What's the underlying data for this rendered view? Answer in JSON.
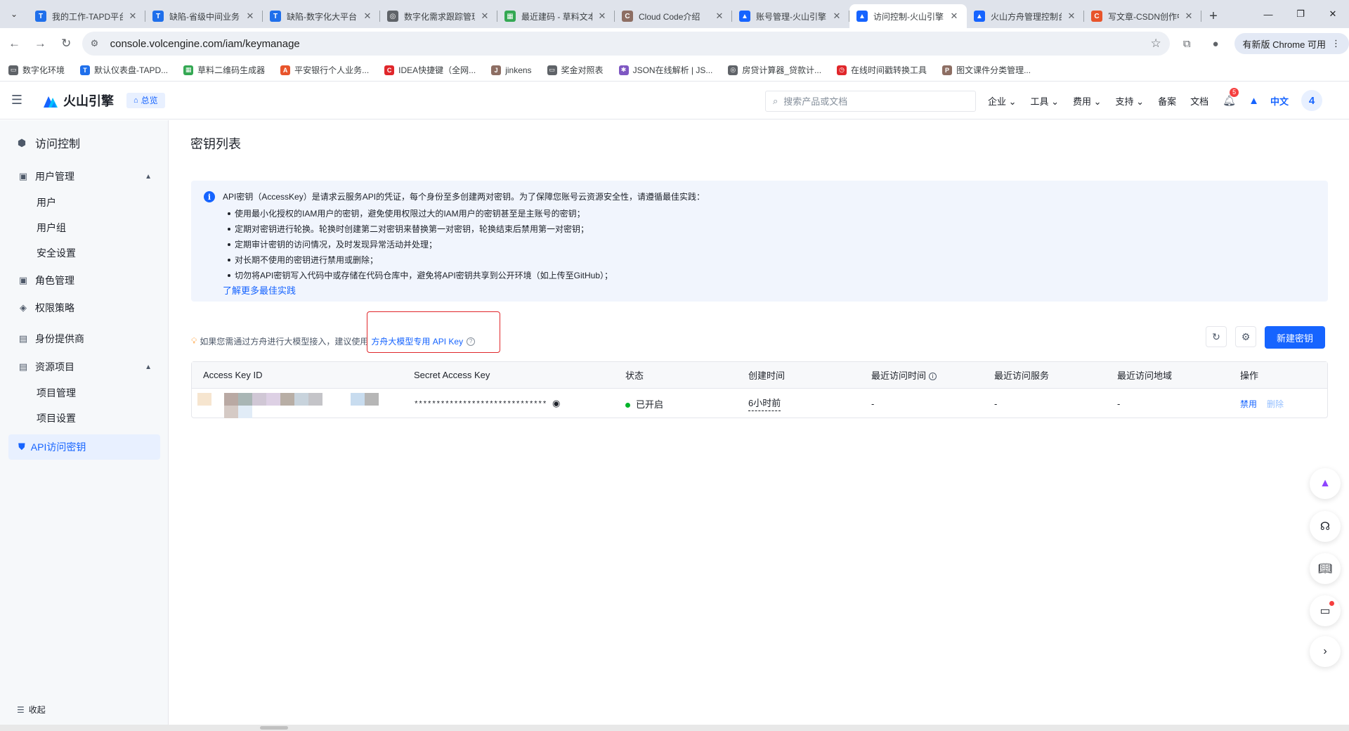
{
  "browser": {
    "tabs": [
      {
        "title": "我的工作-TAPD平台",
        "fav_color": "#1f6feb",
        "fav": "T"
      },
      {
        "title": "缺陷-省级中间业务",
        "fav_color": "#1f6feb",
        "fav": "T"
      },
      {
        "title": "缺陷-数字化大平台",
        "fav_color": "#1f6feb",
        "fav": "T"
      },
      {
        "title": "数字化需求跟踪管理",
        "fav_color": "#5f6368",
        "fav": "◎"
      },
      {
        "title": "最近建码 - 草料文本",
        "fav_color": "#34a853",
        "fav": "▦"
      },
      {
        "title": "Cloud Code介绍",
        "fav_color": "#8d6e63",
        "fav": "C"
      },
      {
        "title": "账号管理-火山引擎",
        "fav_color": "#1664ff",
        "fav": "▲"
      },
      {
        "title": "访问控制-火山引擎",
        "fav_color": "#1664ff",
        "fav": "▲",
        "active": true
      },
      {
        "title": "火山方舟管理控制台",
        "fav_color": "#1664ff",
        "fav": "▲"
      },
      {
        "title": "写文章-CSDN创作中心",
        "fav_color": "#e8542b",
        "fav": "C"
      }
    ],
    "url": "console.volcengine.com/iam/keymanage",
    "update_label": "有新版 Chrome 可用",
    "bookmarks": [
      {
        "label": "数字化环境",
        "color": "#5f6368",
        "fav": "▭"
      },
      {
        "label": "默认仪表盘-TAPD...",
        "color": "#1f6feb",
        "fav": "T"
      },
      {
        "label": "草料二维码生成器",
        "color": "#34a853",
        "fav": "▦"
      },
      {
        "label": "平安银行个人业务...",
        "color": "#e8542b",
        "fav": "A"
      },
      {
        "label": "IDEA快捷键（全网...",
        "color": "#e0272b",
        "fav": "C"
      },
      {
        "label": "jinkens",
        "color": "#8d6e63",
        "fav": "J"
      },
      {
        "label": "奖金对照表",
        "color": "#5f6368",
        "fav": "▭"
      },
      {
        "label": "JSON在线解析 | JS...",
        "color": "#7e57c2",
        "fav": "✱"
      },
      {
        "label": "房贷计算器_贷款计...",
        "color": "#5f6368",
        "fav": "◎"
      },
      {
        "label": "在线时间戳转换工具",
        "color": "#e0272b",
        "fav": "◷"
      },
      {
        "label": "图文课件分类管理...",
        "color": "#8d6e63",
        "fav": "P"
      }
    ]
  },
  "header": {
    "brand": "火山引擎",
    "overview": "总览",
    "search_placeholder": "搜索产品或文档",
    "menus": [
      "企业 ⌄",
      "工具 ⌄",
      "费用 ⌄",
      "支持 ⌄",
      "备案",
      "文档"
    ],
    "badge_count": "5",
    "lang": "中文",
    "avatar": "4"
  },
  "sidebar": {
    "title": "访问控制",
    "groups": {
      "user_mgmt": "用户管理",
      "role_mgmt": "角色管理",
      "policy": "权限策略",
      "idp": "身份提供商",
      "resource": "资源项目"
    },
    "items": {
      "user": "用户",
      "user_group": "用户组",
      "security": "安全设置",
      "project_mgmt": "项目管理",
      "project_settings": "项目设置"
    },
    "active": "API访问密钥",
    "collapse": "收起"
  },
  "main": {
    "title": "密钥列表",
    "notice": {
      "head": "API密钥（AccessKey）是请求云服务API的凭证，每个身份至多创建两对密钥。为了保障您账号云资源安全性，请遵循最佳实践：",
      "items": [
        "使用最小化授权的IAM用户的密钥，避免使用权限过大的IAM用户的密钥甚至是主账号的密钥；",
        "定期对密钥进行轮换。轮换时创建第二对密钥来替换第一对密钥，轮换结束后禁用第一对密钥；",
        "定期审计密钥的访问情况，及时发现异常活动并处理；",
        "对长期不使用的密钥进行禁用或删除；",
        "切勿将API密钥写入代码中或存储在代码仓库中，避免将API密钥共享到公开环境（如上传至GitHub）；"
      ],
      "more": "了解更多最佳实践"
    },
    "hint": "如果您需通过方舟进行大模型接入，建议使用",
    "hint_link": "方舟大模型专用 API Key",
    "new_button": "新建密钥",
    "table": {
      "headers": [
        "Access Key ID",
        "Secret Access Key",
        "状态",
        "创建时间",
        "最近访问时间",
        "最近访问服务",
        "最近访问地域",
        "操作"
      ],
      "row": {
        "secret": "******************************",
        "status": "已开启",
        "created": "6小时前",
        "last_time": "-",
        "last_service": "-",
        "last_region": "-",
        "op_disable": "禁用",
        "op_delete": "删除"
      }
    }
  }
}
